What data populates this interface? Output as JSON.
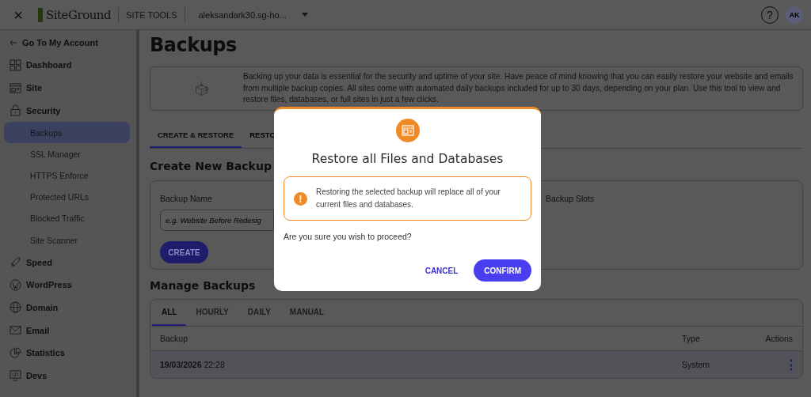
{
  "topbar": {
    "close": "×",
    "brand": "SiteGround",
    "section": "SITE TOOLS",
    "site": "aleksandark30.sg-ho...",
    "help": "?",
    "avatar": "AK"
  },
  "sidebar": {
    "back": "Go To My Account",
    "items": [
      {
        "label": "Dashboard",
        "selected": false
      },
      {
        "label": "Site",
        "selected": false
      },
      {
        "label": "Security",
        "selected": false,
        "children": [
          {
            "label": "Backups",
            "selected": true
          },
          {
            "label": "SSL Manager",
            "selected": false
          },
          {
            "label": "HTTPS Enforce",
            "selected": false
          },
          {
            "label": "Protected URLs",
            "selected": false
          },
          {
            "label": "Blocked Traffic",
            "selected": false
          },
          {
            "label": "Site Scanner",
            "selected": false
          }
        ]
      },
      {
        "label": "Speed",
        "selected": false
      },
      {
        "label": "WordPress",
        "selected": false
      },
      {
        "label": "Domain",
        "selected": false
      },
      {
        "label": "Email",
        "selected": false
      },
      {
        "label": "Statistics",
        "selected": false
      },
      {
        "label": "Devs",
        "selected": false
      }
    ]
  },
  "page": {
    "title": "Backups",
    "intro": "Backing up your data is essential for the security and uptime of your site. Have peace of mind knowing that you can easily restore your website and emails from multiple backup copies. All sites come with automated daily backups included for up to 30 days, depending on your plan. Use this tool to view and restore files, databases, or full sites in just a few clicks.",
    "tabs": [
      {
        "label": "CREATE & RESTORE",
        "selected": true
      },
      {
        "label": "RESTO",
        "selected": false
      }
    ],
    "create": {
      "title": "Create New Backup",
      "name_label": "Backup Name",
      "placeholder": "e.g. Website Before Redesig",
      "slots_label": "Backup Slots",
      "button": "CREATE"
    },
    "manage": {
      "title": "Manage Backups",
      "tabs": [
        {
          "label": "ALL",
          "selected": true
        },
        {
          "label": "HOURLY",
          "selected": false
        },
        {
          "label": "DAILY",
          "selected": false
        },
        {
          "label": "MANUAL",
          "selected": false
        }
      ],
      "columns": [
        "Backup",
        "Type",
        "Actions"
      ],
      "rows": [
        {
          "date": "19/03/2026",
          "time": "22:28",
          "type": "System",
          "actions": "⋮"
        }
      ]
    }
  },
  "dialog": {
    "title": "Restore all Files and Databases",
    "warning_icon": "!",
    "warning": "Restoring the selected backup will replace all of your current files and databases.",
    "question": "Are you sure you wish to proceed?",
    "cancel": "CANCEL",
    "confirm": "CONFIRM"
  }
}
